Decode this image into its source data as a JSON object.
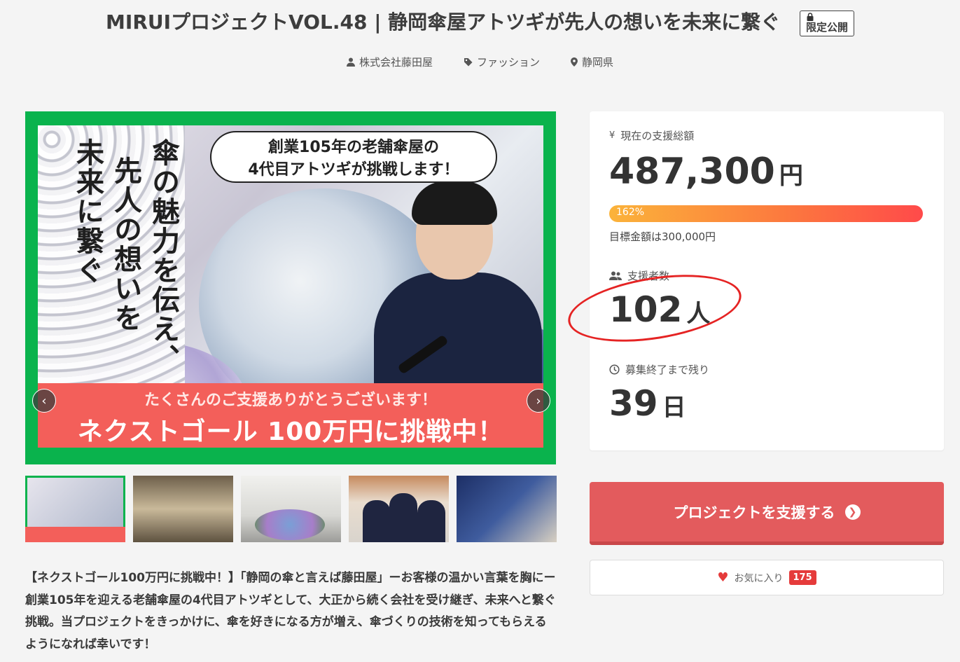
{
  "project": {
    "title": "MIRUIプロジェクトVOL.48 | 静岡傘屋アトツギが先人の想いを未来に繋ぐ",
    "limited_badge": "限定公開",
    "owner": "株式会社藤田屋",
    "category": "ファッション",
    "location": "静岡県"
  },
  "hero": {
    "vertical_text_1": "傘の魅力を伝え、",
    "vertical_text_2": "先人の想いを",
    "vertical_text_3": "未来に繋ぐ",
    "bubble_line1": "創業105年の老舗傘屋の",
    "bubble_line2": "4代目アトツギが挑戦します！",
    "banner_line1": "たくさんのご支援ありがとうございます！",
    "banner_line2": "ネクストゴール 100万円に挑戦中！",
    "prev_icon": "chevron-left-icon",
    "next_icon": "chevron-right-icon"
  },
  "description": "【ネクストゴール100万円に挑戦中！】「静岡の傘と言えば藤田屋」ーお客様の温かい言葉を胸にー 創業105年を迎える老舗傘屋の4代目アトツギとして、大正から続く会社を受け継ぎ、未来へと繋ぐ挑戦。当プロジェクトをきっかけに、傘を好きになる方が増え、傘づくりの技術を知ってもらえるようになれば幸いです！",
  "stats": {
    "total_label": "現在の支援総額",
    "total_amount": "487,300",
    "currency_unit": "円",
    "progress_percent_text": "162%",
    "progress_fraction": 1.62,
    "goal_text": "目標金額は300,000円",
    "supporters_label": "支援者数",
    "supporters_count": "102",
    "supporters_unit": "人",
    "remaining_label": "募集終了まで残り",
    "remaining_days": "39",
    "remaining_unit": "日"
  },
  "actions": {
    "support_button": "プロジェクトを支援する",
    "favorite_button": "お気に入り",
    "favorite_count": "175"
  },
  "colors": {
    "hero_frame": "#0ab34d",
    "support_button": "#e35b5d",
    "annotation_circle": "#e52323",
    "badge_red": "#e53b3b"
  }
}
